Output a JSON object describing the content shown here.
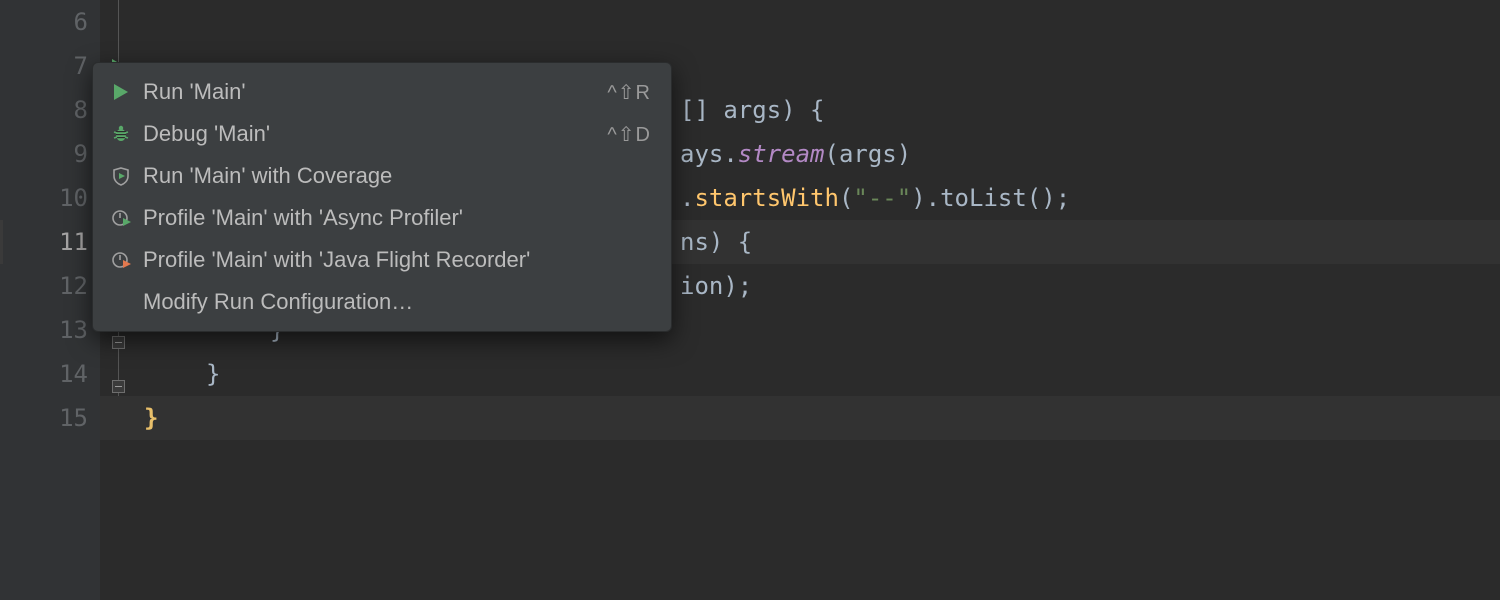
{
  "gutter": {
    "lines": [
      "6",
      "7",
      "8",
      "9",
      "10",
      "11",
      "12",
      "13",
      "14",
      "15"
    ],
    "currentIndex": 5,
    "runMarkers": [
      1,
      2
    ]
  },
  "code": {
    "frag_args": "[] args) {",
    "frag_stream_pre": "ays.",
    "frag_stream": "stream",
    "frag_stream_post": "(args)",
    "frag_starts_pre": ".",
    "frag_starts": "startsWith",
    "frag_starts_arg": "(\"--\")",
    "frag_starts_post": ").toList();",
    "frag_ns": "ns) {",
    "frag_ion": "ion);",
    "brace1": "}",
    "brace2": "}",
    "brace3": "}"
  },
  "menu": {
    "items": [
      {
        "icon": "run",
        "label": "Run 'Main'",
        "shortcut": "^⇧R"
      },
      {
        "icon": "bug",
        "label": "Debug 'Main'",
        "shortcut": "^⇧D"
      },
      {
        "icon": "shield",
        "label": "Run 'Main' with Coverage",
        "shortcut": ""
      },
      {
        "icon": "clockplay",
        "label": "Profile 'Main' with 'Async Profiler'",
        "shortcut": ""
      },
      {
        "icon": "clockplay2",
        "label": "Profile 'Main' with 'Java Flight Recorder'",
        "shortcut": ""
      },
      {
        "icon": "none",
        "label": "Modify Run Configuration…",
        "shortcut": ""
      }
    ]
  }
}
